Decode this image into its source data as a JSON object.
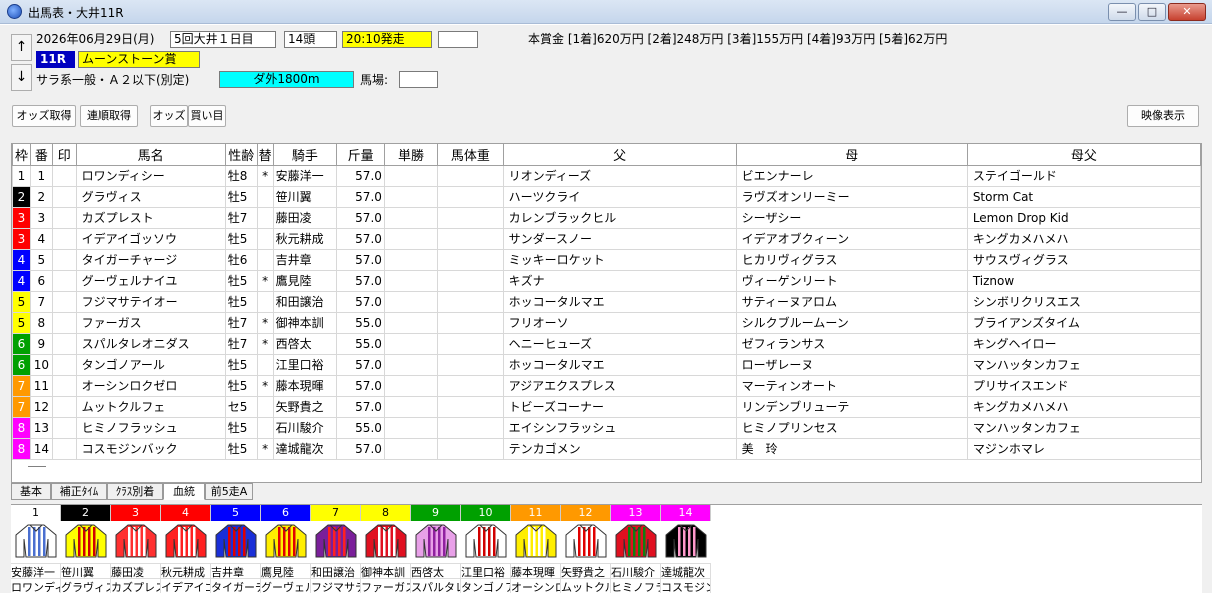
{
  "window": {
    "title": "出馬表・大井11R",
    "minimize": "—",
    "maximize": "□",
    "close": "✕"
  },
  "header": {
    "date": "2026年06月29日(月)",
    "meeting": "5回大井１日目",
    "entries": "14頭",
    "post_time": "20:10発走",
    "race_no": "11R",
    "race_name": "ムーンストーン賞",
    "conditions": "サラ系一般・Ａ２以下(別定)",
    "course": "ダ外1800m",
    "baba_label": "馬場:",
    "baba_value": "",
    "extra_value": "",
    "prize": "本賞金 [1着]620万円 [2着]248万円 [3着]155万円 [4着]93万円 [5着]62万円",
    "up": "↑",
    "down": "↓",
    "post_time_color": "#ffff00",
    "race_name_color": "#ffff00",
    "course_color": "#00ffff"
  },
  "toolbar": {
    "odds_fetch": "オッズ取得",
    "renpuku_fetch": "連順取得",
    "odds": "オッズ",
    "kaime": "買い目",
    "video": "映像表示"
  },
  "columns": [
    "枠",
    "番",
    "印",
    "馬名",
    "性齢",
    "替",
    "騎手",
    "斤量",
    "単勝",
    "馬体重",
    "父",
    "母",
    "母父"
  ],
  "waku_colors": {
    "1": "#ffffff",
    "2": "#000000",
    "3": "#ff0000",
    "4": "#ff0000",
    "5": "#0000ff",
    "6": "#0000ff",
    "7": "#ffff00",
    "8": "#ffff00",
    "9": "#00a000",
    "10": "#00a000",
    "11": "#ff9900",
    "12": "#ff9900",
    "13": "#ff00ff",
    "14": "#ff00ff"
  },
  "rows": [
    {
      "waku": "1",
      "num": "1",
      "mark": "",
      "name": "ロワンディシー",
      "sexage": "牡8",
      "change": "*",
      "jockey": "安藤洋一",
      "weight": "57.0",
      "odds": "",
      "bw": "",
      "sire": "リオンディーズ",
      "dam": "ビエンナーレ",
      "bms": "ステイゴールド"
    },
    {
      "waku": "2",
      "num": "2",
      "mark": "",
      "name": "グラヴィス",
      "sexage": "牡5",
      "change": "",
      "jockey": "笹川翼",
      "weight": "57.0",
      "odds": "",
      "bw": "",
      "sire": "ハーツクライ",
      "dam": "ラヴズオンリーミー",
      "bms": "Storm Cat"
    },
    {
      "waku": "3",
      "num": "3",
      "mark": "",
      "name": "カズプレスト",
      "sexage": "牡7",
      "change": "",
      "jockey": "藤田凌",
      "weight": "57.0",
      "odds": "",
      "bw": "",
      "sire": "カレンブラックヒル",
      "dam": "シーザシー",
      "bms": "Lemon Drop Kid"
    },
    {
      "waku": "3",
      "num": "4",
      "mark": "",
      "name": "イデアイゴッソウ",
      "sexage": "牡5",
      "change": "",
      "jockey": "秋元耕成",
      "weight": "57.0",
      "odds": "",
      "bw": "",
      "sire": "サンダースノー",
      "dam": "イデアオブクィーン",
      "bms": "キングカメハメハ"
    },
    {
      "waku": "4",
      "num": "5",
      "mark": "",
      "name": "タイガーチャージ",
      "sexage": "牡6",
      "change": "",
      "jockey": "吉井章",
      "weight": "57.0",
      "odds": "",
      "bw": "",
      "sire": "ミッキーロケット",
      "dam": "ヒカリヴィグラス",
      "bms": "サウスヴィグラス"
    },
    {
      "waku": "4",
      "num": "6",
      "mark": "",
      "name": "グーヴェルナイユ",
      "sexage": "牡5",
      "change": "*",
      "jockey": "鷹見陸",
      "weight": "57.0",
      "odds": "",
      "bw": "",
      "sire": "キズナ",
      "dam": "ヴィーゲンリート",
      "bms": "Tiznow"
    },
    {
      "waku": "5",
      "num": "7",
      "mark": "",
      "name": "フジマサテイオー",
      "sexage": "牡5",
      "change": "",
      "jockey": "和田譲治",
      "weight": "57.0",
      "odds": "",
      "bw": "",
      "sire": "ホッコータルマエ",
      "dam": "サティーヌアロム",
      "bms": "シンボリクリスエス"
    },
    {
      "waku": "5",
      "num": "8",
      "mark": "",
      "name": "ファーガス",
      "sexage": "牡7",
      "change": "*",
      "jockey": "御神本訓",
      "weight": "55.0",
      "odds": "",
      "bw": "",
      "sire": "フリオーソ",
      "dam": "シルクブルームーン",
      "bms": "ブライアンズタイム"
    },
    {
      "waku": "6",
      "num": "9",
      "mark": "",
      "name": "スパルタレオニダス",
      "sexage": "牡7",
      "change": "*",
      "jockey": "西啓太",
      "weight": "55.0",
      "odds": "",
      "bw": "",
      "sire": "ヘニーヒューズ",
      "dam": "ゼフィランサス",
      "bms": "キングヘイロー"
    },
    {
      "waku": "6",
      "num": "10",
      "mark": "",
      "name": "タンゴノアール",
      "sexage": "牡5",
      "change": "",
      "jockey": "江里口裕",
      "weight": "57.0",
      "odds": "",
      "bw": "",
      "sire": "ホッコータルマエ",
      "dam": "ローザレーヌ",
      "bms": "マンハッタンカフェ"
    },
    {
      "waku": "7",
      "num": "11",
      "mark": "",
      "name": "オーシンロクゼロ",
      "sexage": "牡5",
      "change": "*",
      "jockey": "藤本現暉",
      "weight": "57.0",
      "odds": "",
      "bw": "",
      "sire": "アジアエクスプレス",
      "dam": "マーティンオート",
      "bms": "プリサイスエンド"
    },
    {
      "waku": "7",
      "num": "12",
      "mark": "",
      "name": "ムットクルフェ",
      "sexage": "セ5",
      "change": "",
      "jockey": "矢野貴之",
      "weight": "57.0",
      "odds": "",
      "bw": "",
      "sire": "トビーズコーナー",
      "dam": "リンデンブリューテ",
      "bms": "キングカメハメハ"
    },
    {
      "waku": "8",
      "num": "13",
      "mark": "",
      "name": "ヒミノフラッシュ",
      "sexage": "牡5",
      "change": "",
      "jockey": "石川駿介",
      "weight": "55.0",
      "odds": "",
      "bw": "",
      "sire": "エイシンフラッシュ",
      "dam": "ヒミノプリンセス",
      "bms": "マンハッタンカフェ"
    },
    {
      "waku": "8",
      "num": "14",
      "mark": "",
      "name": "コスモジンバック",
      "sexage": "牡5",
      "change": "*",
      "jockey": "達城龍次",
      "weight": "57.0",
      "odds": "",
      "bw": "",
      "sire": "テンカゴメン",
      "dam": "美　玲",
      "bms": "マジンホマレ"
    }
  ],
  "bottom_tabs": [
    "基本",
    "補正ﾀｲﾑ",
    "ｸﾗｽ別着",
    "血統",
    "前5走A"
  ],
  "silks": [
    {
      "no": "1",
      "jockey": "安藤洋一",
      "horse": "ロワンディ",
      "bg": "#ffffff",
      "fg": "#000000",
      "body": "#ffffff",
      "pattern": "#4a6fd0"
    },
    {
      "no": "2",
      "jockey": "笹川翼",
      "horse": "グラヴィス",
      "bg": "#000000",
      "fg": "#ffffff",
      "body": "#ffff00",
      "pattern": "#d00000"
    },
    {
      "no": "3",
      "jockey": "藤田凌",
      "horse": "カズプレス",
      "bg": "#ff0000",
      "fg": "#ffffff",
      "body": "#ff3030",
      "pattern": "#ffffff"
    },
    {
      "no": "4",
      "jockey": "秋元耕成",
      "horse": "イデアイゴ",
      "bg": "#ff0000",
      "fg": "#ffffff",
      "body": "#ff2020",
      "pattern": "#ffffff"
    },
    {
      "no": "5",
      "jockey": "吉井章",
      "horse": "タイガーチ",
      "bg": "#0000ff",
      "fg": "#ffffff",
      "body": "#1a2fd8",
      "pattern": "#e00000"
    },
    {
      "no": "6",
      "jockey": "鷹見陸",
      "horse": "グーヴェル",
      "bg": "#0000ff",
      "fg": "#ffffff",
      "body": "#ffee00",
      "pattern": "#e00000"
    },
    {
      "no": "7",
      "jockey": "和田譲治",
      "horse": "フジマサテ",
      "bg": "#ffff00",
      "fg": "#000000",
      "body": "#7a1f9a",
      "pattern": "#ff2020"
    },
    {
      "no": "8",
      "jockey": "御神本訓",
      "horse": "ファーガス",
      "bg": "#ffff00",
      "fg": "#000000",
      "body": "#e01020",
      "pattern": "#ffffff"
    },
    {
      "no": "9",
      "jockey": "西啓太",
      "horse": "スパルタレ",
      "bg": "#00a000",
      "fg": "#ffffff",
      "body": "#e8a0e8",
      "pattern": "#9020a0"
    },
    {
      "no": "10",
      "jockey": "江里口裕",
      "horse": "タンゴノア",
      "bg": "#00a000",
      "fg": "#ffffff",
      "body": "#ffffff",
      "pattern": "#d00000"
    },
    {
      "no": "11",
      "jockey": "藤本現暉",
      "horse": "オーシンロ",
      "bg": "#ff9900",
      "fg": "#ffffff",
      "body": "#ffee00",
      "pattern": "#ffffff"
    },
    {
      "no": "12",
      "jockey": "矢野貴之",
      "horse": "ムットクル",
      "bg": "#ff9900",
      "fg": "#ffffff",
      "body": "#ffffff",
      "pattern": "#e00000"
    },
    {
      "no": "13",
      "jockey": "石川駿介",
      "horse": "ヒミノフラ",
      "bg": "#ff00ff",
      "fg": "#ffffff",
      "body": "#e01020",
      "pattern": "#108010"
    },
    {
      "no": "14",
      "jockey": "達城龍次",
      "horse": "コスモジン",
      "bg": "#ff00ff",
      "fg": "#ffffff",
      "body": "#000000",
      "pattern": "#ff99cc"
    }
  ]
}
